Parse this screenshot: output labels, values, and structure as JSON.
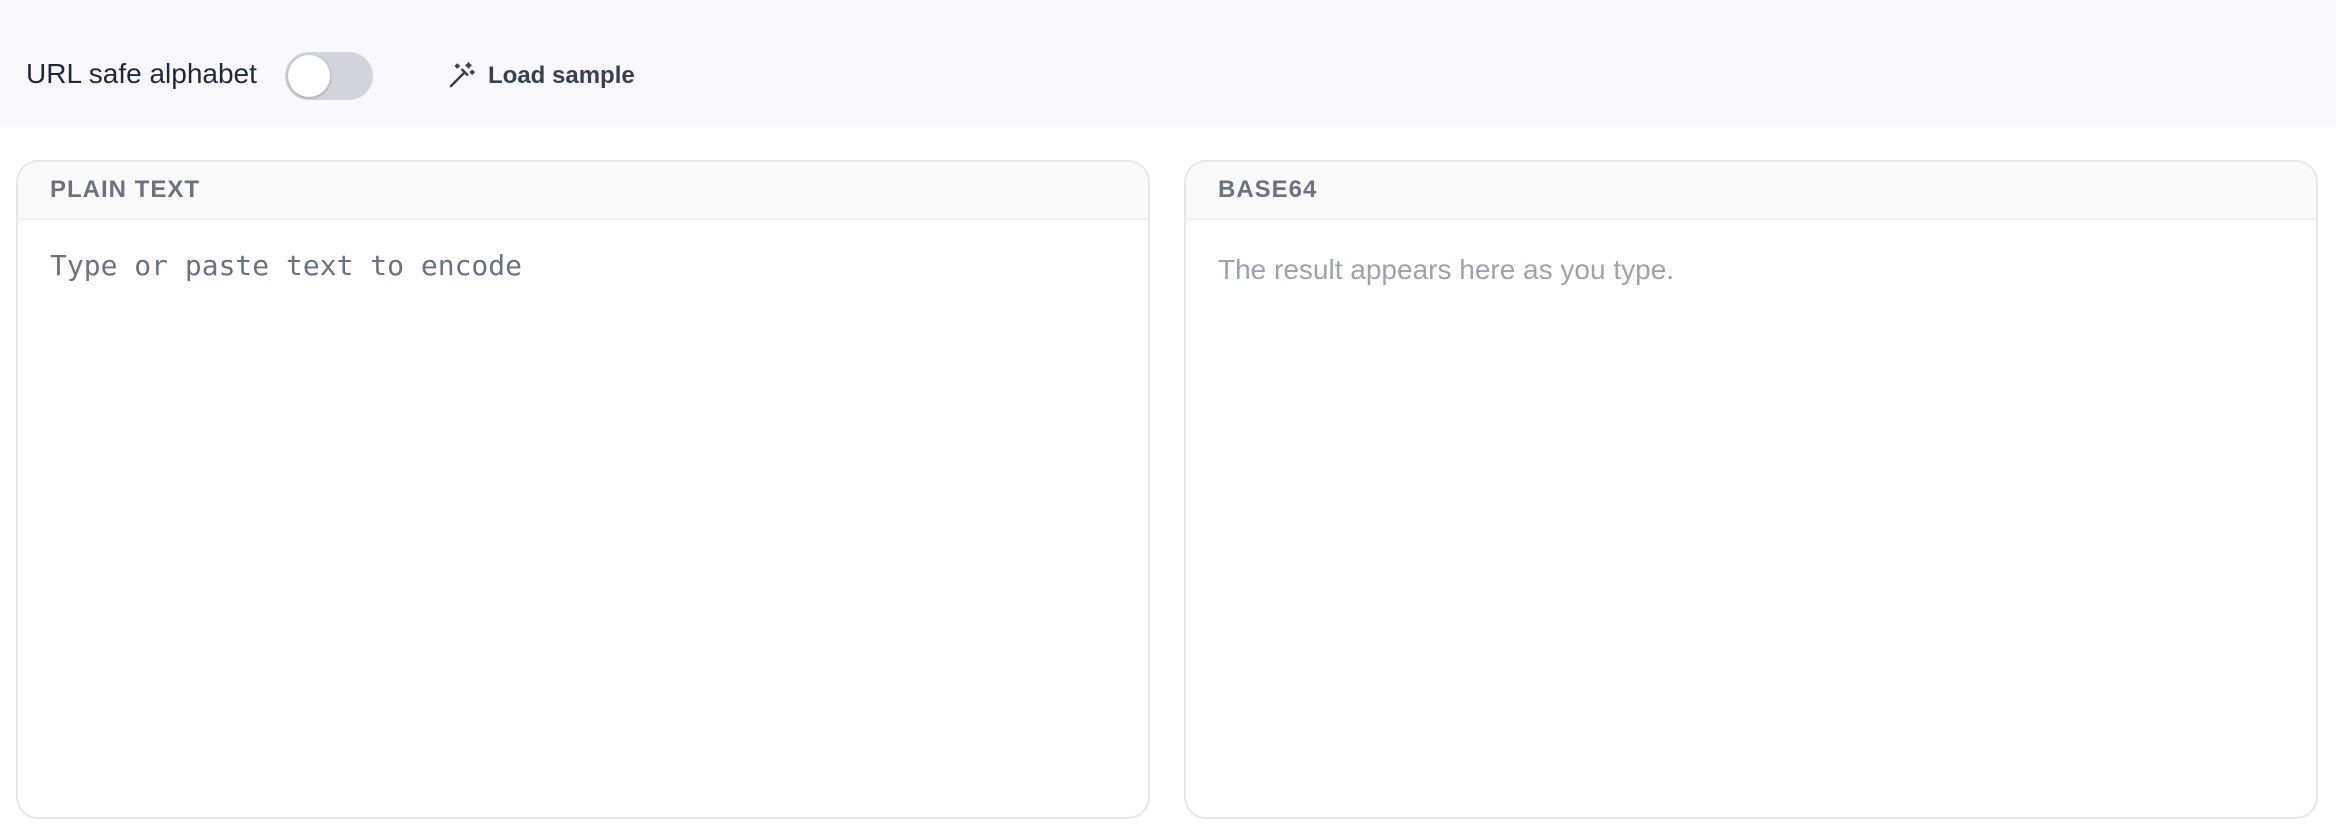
{
  "toolbar": {
    "url_safe_label": "URL safe alphabet",
    "url_safe_enabled": false,
    "load_sample_label": "Load sample",
    "load_sample_icon": "magic-wand-icon"
  },
  "input_panel": {
    "title": "PLAIN TEXT",
    "placeholder": "Type or paste text to encode",
    "value": ""
  },
  "output_panel": {
    "title": "BASE64",
    "placeholder_text": "The result appears here as you type."
  },
  "colors": {
    "toolbar_bg": "#f9f8fe",
    "toggle_off": "#d1d5db",
    "panel_border": "#e5e7eb",
    "header_text": "#6b7280",
    "placeholder": "#9ca3af"
  }
}
